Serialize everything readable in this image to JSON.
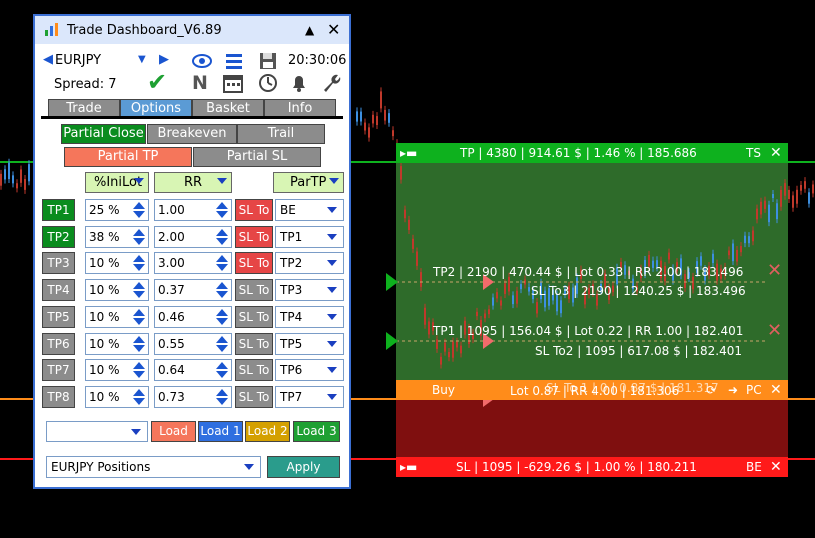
{
  "panel": {
    "title": "Trade Dashboard_V6.89",
    "minimize_glyph": "▲",
    "close_glyph": "✕",
    "symbol": "EURJPY",
    "time": "20:30:06",
    "spread_label": "Spread: 7",
    "icons": [
      "eye-icon",
      "menu-icon",
      "save-icon",
      "checkmark-icon",
      "news-icon",
      "calendar-icon",
      "clock-icon",
      "bell-icon",
      "wrench-icon"
    ],
    "news_letter": "N",
    "tabs": [
      "Trade",
      "Options",
      "Basket",
      "Info"
    ],
    "active_tab": "Options",
    "subtabs": [
      "Partial Close",
      "Breakeven",
      "Trail"
    ],
    "subtabs2": [
      "Partial TP",
      "Partial SL"
    ],
    "headers": {
      "lot": "%IniLot",
      "rr": "RR",
      "partp": "ParTP"
    },
    "rows": [
      {
        "label": "TP1",
        "on": true,
        "lot": "25 %",
        "rr": "1.00",
        "slto": "SL To",
        "slto_red": true,
        "par": "BE"
      },
      {
        "label": "TP2",
        "on": true,
        "lot": "38 %",
        "rr": "2.00",
        "slto": "SL To",
        "slto_red": true,
        "par": "TP1"
      },
      {
        "label": "TP3",
        "on": false,
        "lot": "10 %",
        "rr": "3.00",
        "slto": "SL To",
        "slto_red": true,
        "par": "TP2"
      },
      {
        "label": "TP4",
        "on": false,
        "lot": "10 %",
        "rr": "0.37",
        "slto": "SL To",
        "slto_red": false,
        "par": "TP3"
      },
      {
        "label": "TP5",
        "on": false,
        "lot": "10 %",
        "rr": "0.46",
        "slto": "SL To",
        "slto_red": false,
        "par": "TP4"
      },
      {
        "label": "TP6",
        "on": false,
        "lot": "10 %",
        "rr": "0.55",
        "slto": "SL To",
        "slto_red": false,
        "par": "TP5"
      },
      {
        "label": "TP7",
        "on": false,
        "lot": "10 %",
        "rr": "0.64",
        "slto": "SL To",
        "slto_red": false,
        "par": "TP6"
      },
      {
        "label": "TP8",
        "on": false,
        "lot": "10 %",
        "rr": "0.73",
        "slto": "SL To",
        "slto_red": false,
        "par": "TP7"
      }
    ],
    "load_buttons": [
      {
        "label": "Load",
        "color": "#f5765b"
      },
      {
        "label": "Load 1",
        "color": "#2f6fe0"
      },
      {
        "label": "Load 2",
        "color": "#d4a000"
      },
      {
        "label": "Load 3",
        "color": "#1ea032"
      }
    ],
    "positions_select": "EURJPY Positions",
    "apply_label": "Apply"
  },
  "overlay": {
    "tp_bar": "TP | 4380 | 914.61 $ | 1.46 % | 185.686",
    "tp_right": "TS",
    "tp2_line": "TP2 | 2190 | 470.44 $ | Lot 0.33 | RR 2.00 | 183.496",
    "slto3_line": "SL To3 | 2190 | 1240.25 $ | 183.496",
    "tp1_line": "TP1 | 1095 | 156.04 $ | Lot 0.22 | RR 1.00 | 182.401",
    "slto2_line": "SL To2 | 1095 | 617.08 $ | 182.401",
    "buy_label": "Buy",
    "entry_line": "Lot 0.87 | RR 4.00 | 181.306",
    "entry_overlap": "SL To 1 | 0 | 0.87 $ | 181.317",
    "pc_label": "PC",
    "sl_bar": "SL | 1095 | -629.26 $ | 1.00 % | 180.211",
    "sl_right": "BE",
    "colors": {
      "tp_green": "#0eb11e",
      "tp_zone": "#2e6b2a",
      "sl_red": "#ff1a1a",
      "sl_zone": "#7f0f0f",
      "buy_orange": "#ff8c1a",
      "delete_red": "#e06060"
    }
  }
}
